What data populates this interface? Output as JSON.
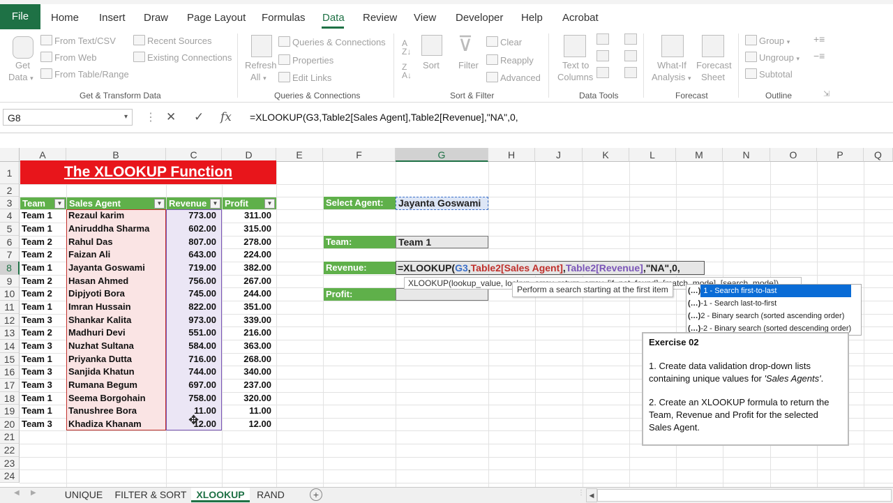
{
  "ribbon": {
    "tabs": [
      "File",
      "Home",
      "Insert",
      "Draw",
      "Page Layout",
      "Formulas",
      "Data",
      "Review",
      "View",
      "Developer",
      "Help",
      "Acrobat"
    ],
    "active_tab": "Data",
    "get_transform": {
      "get_data": "Get",
      "get_data2": "Data",
      "from_text_csv": "From Text/CSV",
      "from_web": "From Web",
      "from_table_range": "From Table/Range",
      "recent_sources": "Recent Sources",
      "existing_connections": "Existing Connections",
      "group_label": "Get & Transform Data"
    },
    "queries": {
      "refresh": "Refresh",
      "refresh_all": "All",
      "queries_connections": "Queries & Connections",
      "properties": "Properties",
      "edit_links": "Edit Links",
      "group_label": "Queries & Connections"
    },
    "sort_filter": {
      "sort": "Sort",
      "filter": "Filter",
      "clear": "Clear",
      "reapply": "Reapply",
      "advanced": "Advanced",
      "group_label": "Sort & Filter"
    },
    "data_tools": {
      "text_to": "Text to",
      "columns": "Columns",
      "group_label": "Data Tools"
    },
    "forecast": {
      "whatif": "What-If",
      "analysis": "Analysis",
      "forecast": "Forecast",
      "sheet": "Sheet",
      "group_label": "Forecast"
    },
    "outline": {
      "group": "Group",
      "ungroup": "Ungroup",
      "subtotal": "Subtotal",
      "group_label": "Outline"
    }
  },
  "formula_bar": {
    "name_box": "G8",
    "cancel": "✕",
    "enter": "✓",
    "fx": "fx",
    "formula": "=XLOOKUP(G3,Table2[Sales Agent],Table2[Revenue],\"NA\",0,"
  },
  "columns": [
    "A",
    "B",
    "C",
    "D",
    "E",
    "F",
    "G",
    "H",
    "J",
    "K",
    "L",
    "M",
    "N",
    "O",
    "P",
    "Q"
  ],
  "rows": [
    "1",
    "2",
    "3",
    "4",
    "5",
    "6",
    "7",
    "8",
    "9",
    "10",
    "11",
    "12",
    "13",
    "14",
    "15",
    "16",
    "17",
    "18",
    "19",
    "20",
    "21",
    "22",
    "23",
    "24"
  ],
  "title": "The XLOOKUP Function",
  "table": {
    "headers": [
      "Team",
      "Sales Agent",
      "Revenue",
      "Profit"
    ],
    "rows": [
      [
        "Team 1",
        "Rezaul karim",
        "773.00",
        "311.00"
      ],
      [
        "Team 1",
        "Aniruddha Sharma",
        "602.00",
        "315.00"
      ],
      [
        "Team 2",
        "Rahul Das",
        "807.00",
        "278.00"
      ],
      [
        "Team 2",
        "Faizan Ali",
        "643.00",
        "224.00"
      ],
      [
        "Team 1",
        "Jayanta Goswami",
        "719.00",
        "382.00"
      ],
      [
        "Team 2",
        "Hasan Ahmed",
        "756.00",
        "267.00"
      ],
      [
        "Team 2",
        "Dipjyoti Bora",
        "745.00",
        "244.00"
      ],
      [
        "Team 1",
        "Imran Hussain",
        "822.00",
        "351.00"
      ],
      [
        "Team 3",
        "Shankar Kalita",
        "973.00",
        "339.00"
      ],
      [
        "Team 2",
        "Madhuri Devi",
        "551.00",
        "216.00"
      ],
      [
        "Team 3",
        "Nuzhat Sultana",
        "584.00",
        "363.00"
      ],
      [
        "Team 1",
        "Priyanka Dutta",
        "716.00",
        "268.00"
      ],
      [
        "Team 3",
        "Sanjida Khatun",
        "744.00",
        "340.00"
      ],
      [
        "Team 3",
        "Rumana Begum",
        "697.00",
        "237.00"
      ],
      [
        "Team 1",
        "Seema Borgohain",
        "758.00",
        "320.00"
      ],
      [
        "Team 1",
        "Tanushree Bora",
        "11.00",
        "11.00"
      ],
      [
        "Team 3",
        "Khadiza Khanam",
        "12.00",
        "12.00"
      ]
    ]
  },
  "lookup": {
    "select_agent_label": "Select Agent:",
    "select_agent_value": "Jayanta Goswami",
    "team_label": "Team:",
    "team_value": "Team 1",
    "revenue_label": "Revenue:",
    "profit_label": "Profit:",
    "cell_formula": {
      "p1": "=XLOOKUP(",
      "p2": "G3",
      "p3": ",",
      "p4": "Table2[Sales Agent]",
      "p5": ",",
      "p6": "Table2[Revenue]",
      "p7": ",\"NA\",0,"
    }
  },
  "tooltips": {
    "signature": "XLOOKUP(lookup_value, lookup_array, return_array, [if_not_found], [match_mode], [search_mode])",
    "search_hint": "Perform a search starting at the first item",
    "autocomplete": [
      {
        "badge": "(…)",
        "text": "1 - Search first-to-last"
      },
      {
        "badge": "(…)",
        "text": "-1 - Search last-to-first"
      },
      {
        "badge": "(…)",
        "text": "2 - Binary search (sorted ascending order)"
      },
      {
        "badge": "(…)",
        "text": "-2 - Binary search (sorted descending order)"
      }
    ]
  },
  "exercise": {
    "title": "Exercise 02",
    "p1a": "1. Create data validation drop-down lists containing unique values for ",
    "p1b": "'Sales Agents'",
    "p1c": ".",
    "p2": "2. Create an XLOOKUP formula to return the Team, Revenue and Profit for the selected Sales Agent."
  },
  "sheets": [
    "UNIQUE",
    "FILTER & SORT",
    "XLOOKUP",
    "RAND"
  ],
  "active_sheet": "XLOOKUP",
  "colors": {
    "excel_green": "#1e7145",
    "table_header_green": "#5fb04a",
    "title_red": "#e8151b",
    "ref_blue": "#3b6fc8",
    "ref_red": "#c0302c",
    "ref_purple": "#7b55b8"
  }
}
